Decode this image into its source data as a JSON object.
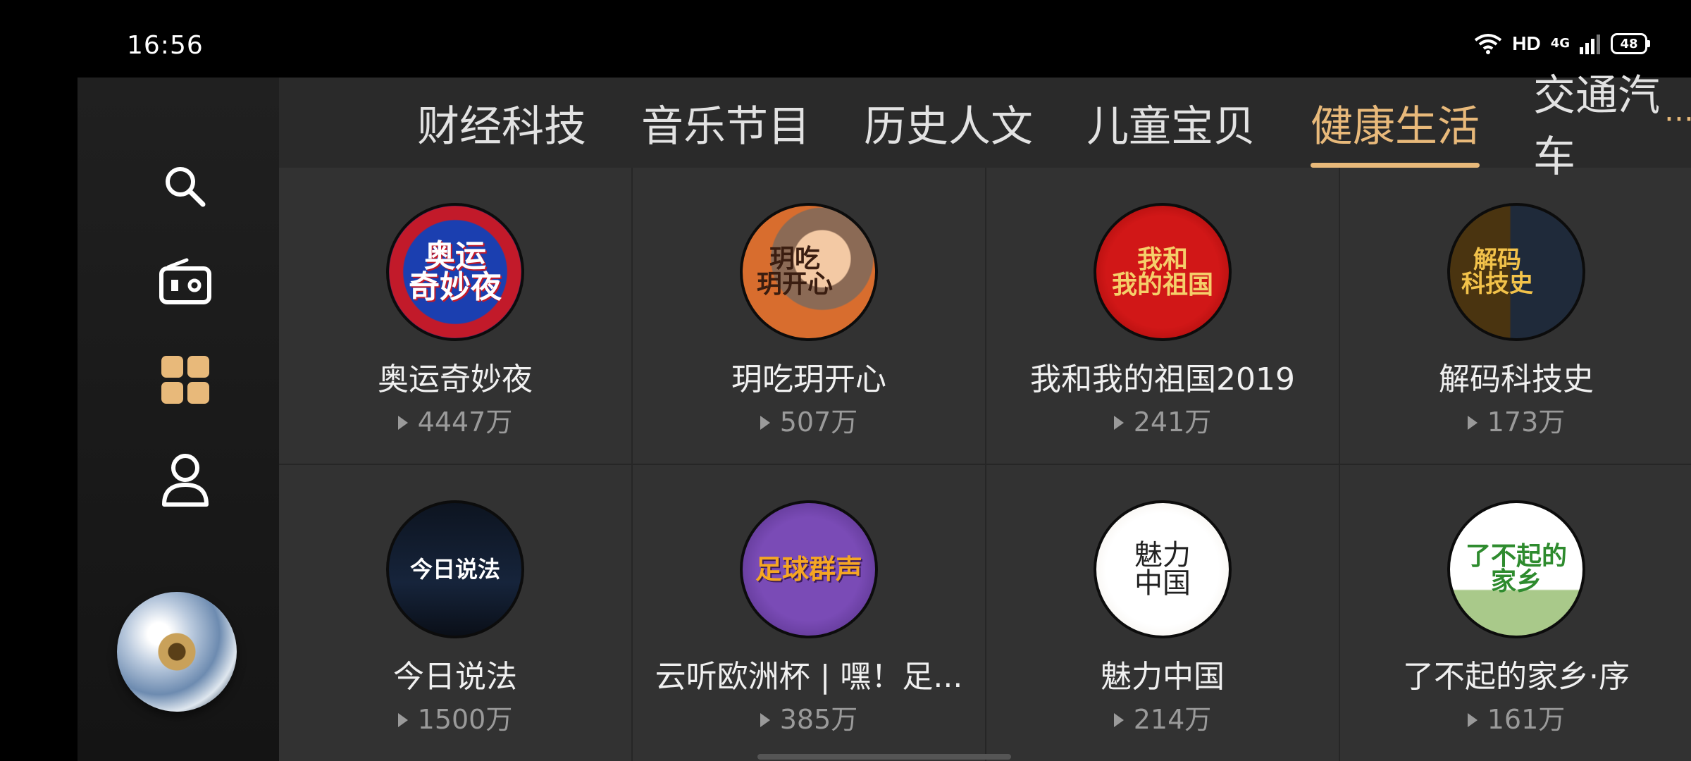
{
  "status": {
    "time": "16:56",
    "hd": "HD",
    "network": "4G",
    "battery": "48"
  },
  "sidebar": {
    "items": [
      {
        "icon": "search-icon"
      },
      {
        "icon": "radio-icon"
      },
      {
        "icon": "grid-icon"
      },
      {
        "icon": "user-icon"
      }
    ],
    "now_playing": {
      "icon": "album-disc-icon"
    }
  },
  "tabs": [
    {
      "label": "财经科技"
    },
    {
      "label": "音乐节目"
    },
    {
      "label": "历史人文"
    },
    {
      "label": "儿童宝贝"
    },
    {
      "label": "健康生活"
    },
    {
      "label": "交通汽车"
    }
  ],
  "active_tab": "健康生活",
  "more_label": "···",
  "accent_color": "#e8b97a",
  "programs": [
    {
      "title": "奥运奇妙夜",
      "plays": "4447万",
      "cover_text": "奥运\n奇妙夜"
    },
    {
      "title": "玥吃玥开心",
      "plays": "507万",
      "cover_text": "玥吃\n玥开心"
    },
    {
      "title": "我和我的祖国2019",
      "plays": "241万",
      "cover_text": "我和\n我的祖国"
    },
    {
      "title": "解码科技史",
      "plays": "173万",
      "cover_text": "解码\n科技史"
    },
    {
      "title": "今日说法",
      "plays": "1500万",
      "cover_text": "今日说法"
    },
    {
      "title": "云听欧洲杯 | 嘿！足...",
      "plays": "385万",
      "cover_text": "足球群声"
    },
    {
      "title": "魅力中国",
      "plays": "214万",
      "cover_text": "魅力\n中国"
    },
    {
      "title": "了不起的家乡·序",
      "plays": "161万",
      "cover_text": "了不起的\n家乡"
    }
  ]
}
